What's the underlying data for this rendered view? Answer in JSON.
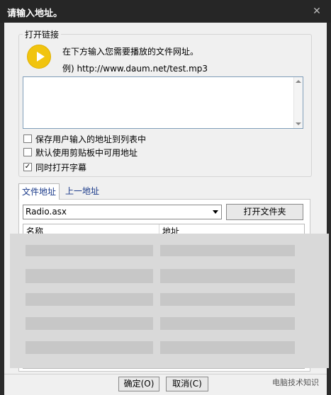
{
  "window": {
    "title": "请输入地址。",
    "close_glyph": "✕"
  },
  "group": {
    "label": "打开链接",
    "instruction": "在下方输入您需要播放的文件网址。",
    "example": "例) http://www.daum.net/test.mp3",
    "url_value": ""
  },
  "options": [
    {
      "label": "保存用户输入的地址到列表中",
      "checked": false
    },
    {
      "label": "默认使用剪贴板中可用地址",
      "checked": false
    },
    {
      "label": "同时打开字幕",
      "checked": true
    }
  ],
  "tabs": [
    {
      "label": "文件地址",
      "active": true
    },
    {
      "label": "上一地址",
      "active": false
    }
  ],
  "file_tab": {
    "combo_value": "Radio.asx",
    "open_folder_label": "打开文件夹",
    "columns": [
      "名称",
      "地址"
    ]
  },
  "footer": {
    "ok_label": "确定(O)",
    "cancel_label": "取消(C)",
    "watermark": "电脑技术知识"
  },
  "icons": {
    "play": "play-icon",
    "close": "close-icon",
    "dropdown": "chevron-down-icon"
  }
}
